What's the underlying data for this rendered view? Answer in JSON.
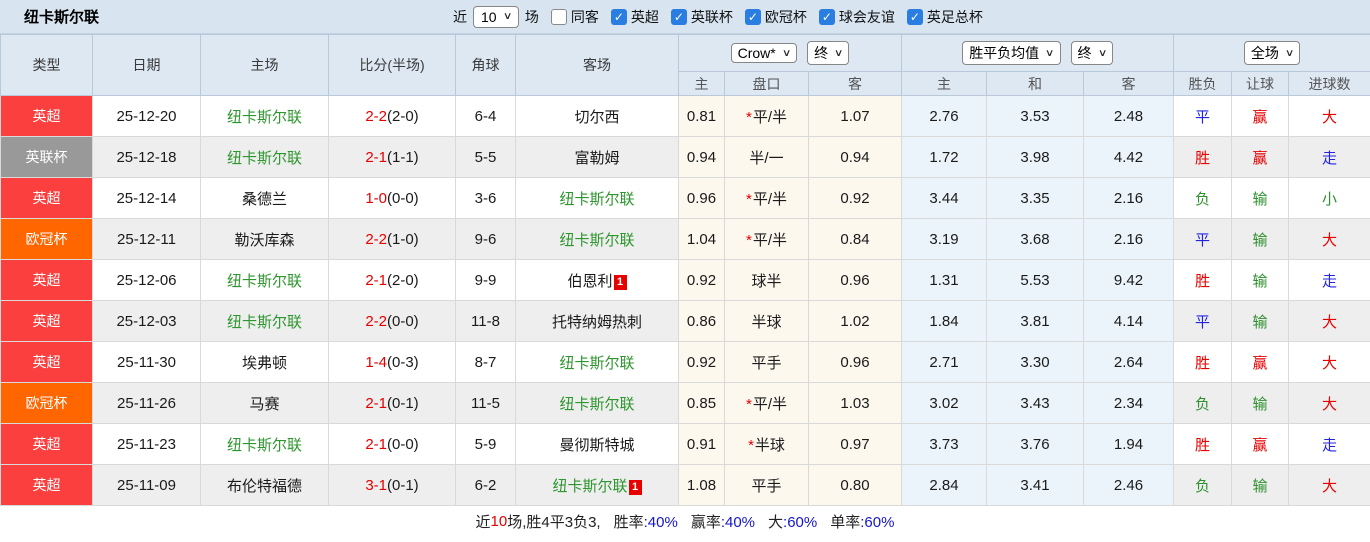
{
  "icons": {
    "chevron_down": "∨",
    "check": "✓"
  },
  "markers": {
    "star": "*"
  },
  "league_colors": {
    "英超": "#fb3e3e",
    "英联杯": "#999999",
    "欧冠杯": "#ff6600"
  },
  "result_colors": {
    "胜": "#e60000",
    "平": "#2424e0",
    "负": "#2e8f2e",
    "赢": "#e60000",
    "输": "#2e8f2e",
    "走": "#2424e0",
    "大": "#e60000",
    "小": "#2e8f2e"
  },
  "topbar": {
    "title": "纽卡斯尔联",
    "recent_label": "近",
    "recent_select": "10",
    "games_label": "场",
    "same_opponent": {
      "label": "同客",
      "checked": false
    },
    "league_filters": [
      {
        "label": "英超",
        "checked": true
      },
      {
        "label": "英联杯",
        "checked": true
      },
      {
        "label": "欧冠杯",
        "checked": true
      },
      {
        "label": "球会友谊",
        "checked": true
      },
      {
        "label": "英足总杯",
        "checked": true
      }
    ]
  },
  "table": {
    "headers": {
      "type": "类型",
      "date": "日期",
      "home": "主场",
      "score": "比分(半场)",
      "corners": "角球",
      "away": "客场",
      "asian_group": {
        "bookmaker_select": "Crow*",
        "time_select": "终",
        "cols": [
          "主",
          "盘口",
          "客"
        ]
      },
      "euro_group": {
        "metric_select": "胜平负均值",
        "time_select": "终",
        "cols": [
          "主",
          "和",
          "客"
        ]
      },
      "result_group": {
        "scope_select": "全场",
        "cols": [
          "胜负",
          "让球",
          "进球数"
        ]
      }
    },
    "matches": [
      {
        "league": "英超",
        "date": "25-12-20",
        "home": "纽卡斯尔联",
        "home_self": true,
        "home_card": "",
        "score_ft": "2-2",
        "score_ht": "(2-0)",
        "corners": "6-4",
        "away": "切尔西",
        "away_self": false,
        "away_card": "",
        "ah_home": "0.81",
        "ah_star": true,
        "ah_line": "平/半",
        "ah_away": "1.07",
        "eu_home": "2.76",
        "eu_draw": "3.53",
        "eu_away": "2.48",
        "r_outcome": "平",
        "r_handicap": "赢",
        "r_goals": "大"
      },
      {
        "league": "英联杯",
        "date": "25-12-18",
        "home": "纽卡斯尔联",
        "home_self": true,
        "home_card": "",
        "score_ft": "2-1",
        "score_ht": "(1-1)",
        "corners": "5-5",
        "away": "富勒姆",
        "away_self": false,
        "away_card": "",
        "ah_home": "0.94",
        "ah_star": false,
        "ah_line": "半/一",
        "ah_away": "0.94",
        "eu_home": "1.72",
        "eu_draw": "3.98",
        "eu_away": "4.42",
        "r_outcome": "胜",
        "r_handicap": "赢",
        "r_goals": "走"
      },
      {
        "league": "英超",
        "date": "25-12-14",
        "home": "桑德兰",
        "home_self": false,
        "home_card": "",
        "score_ft": "1-0",
        "score_ht": "(0-0)",
        "corners": "3-6",
        "away": "纽卡斯尔联",
        "away_self": true,
        "away_card": "",
        "ah_home": "0.96",
        "ah_star": true,
        "ah_line": "平/半",
        "ah_away": "0.92",
        "eu_home": "3.44",
        "eu_draw": "3.35",
        "eu_away": "2.16",
        "r_outcome": "负",
        "r_handicap": "输",
        "r_goals": "小"
      },
      {
        "league": "欧冠杯",
        "date": "25-12-11",
        "home": "勒沃库森",
        "home_self": false,
        "home_card": "",
        "score_ft": "2-2",
        "score_ht": "(1-0)",
        "corners": "9-6",
        "away": "纽卡斯尔联",
        "away_self": true,
        "away_card": "",
        "ah_home": "1.04",
        "ah_star": true,
        "ah_line": "平/半",
        "ah_away": "0.84",
        "eu_home": "3.19",
        "eu_draw": "3.68",
        "eu_away": "2.16",
        "r_outcome": "平",
        "r_handicap": "输",
        "r_goals": "大"
      },
      {
        "league": "英超",
        "date": "25-12-06",
        "home": "纽卡斯尔联",
        "home_self": true,
        "home_card": "",
        "score_ft": "2-1",
        "score_ht": "(2-0)",
        "corners": "9-9",
        "away": "伯恩利",
        "away_self": false,
        "away_card": "1",
        "ah_home": "0.92",
        "ah_star": false,
        "ah_line": "球半",
        "ah_away": "0.96",
        "eu_home": "1.31",
        "eu_draw": "5.53",
        "eu_away": "9.42",
        "r_outcome": "胜",
        "r_handicap": "输",
        "r_goals": "走"
      },
      {
        "league": "英超",
        "date": "25-12-03",
        "home": "纽卡斯尔联",
        "home_self": true,
        "home_card": "",
        "score_ft": "2-2",
        "score_ht": "(0-0)",
        "corners": "11-8",
        "away": "托特纳姆热刺",
        "away_self": false,
        "away_card": "",
        "ah_home": "0.86",
        "ah_star": false,
        "ah_line": "半球",
        "ah_away": "1.02",
        "eu_home": "1.84",
        "eu_draw": "3.81",
        "eu_away": "4.14",
        "r_outcome": "平",
        "r_handicap": "输",
        "r_goals": "大"
      },
      {
        "league": "英超",
        "date": "25-11-30",
        "home": "埃弗顿",
        "home_self": false,
        "home_card": "",
        "score_ft": "1-4",
        "score_ht": "(0-3)",
        "corners": "8-7",
        "away": "纽卡斯尔联",
        "away_self": true,
        "away_card": "",
        "ah_home": "0.92",
        "ah_star": false,
        "ah_line": "平手",
        "ah_away": "0.96",
        "eu_home": "2.71",
        "eu_draw": "3.30",
        "eu_away": "2.64",
        "r_outcome": "胜",
        "r_handicap": "赢",
        "r_goals": "大"
      },
      {
        "league": "欧冠杯",
        "date": "25-11-26",
        "home": "马赛",
        "home_self": false,
        "home_card": "",
        "score_ft": "2-1",
        "score_ht": "(0-1)",
        "corners": "11-5",
        "away": "纽卡斯尔联",
        "away_self": true,
        "away_card": "",
        "ah_home": "0.85",
        "ah_star": true,
        "ah_line": "平/半",
        "ah_away": "1.03",
        "eu_home": "3.02",
        "eu_draw": "3.43",
        "eu_away": "2.34",
        "r_outcome": "负",
        "r_handicap": "输",
        "r_goals": "大"
      },
      {
        "league": "英超",
        "date": "25-11-23",
        "home": "纽卡斯尔联",
        "home_self": true,
        "home_card": "",
        "score_ft": "2-1",
        "score_ht": "(0-0)",
        "corners": "5-9",
        "away": "曼彻斯特城",
        "away_self": false,
        "away_card": "",
        "ah_home": "0.91",
        "ah_star": true,
        "ah_line": "半球",
        "ah_away": "0.97",
        "eu_home": "3.73",
        "eu_draw": "3.76",
        "eu_away": "1.94",
        "r_outcome": "胜",
        "r_handicap": "赢",
        "r_goals": "走"
      },
      {
        "league": "英超",
        "date": "25-11-09",
        "home": "布伦特福德",
        "home_self": false,
        "home_card": "",
        "score_ft": "3-1",
        "score_ht": "(0-1)",
        "corners": "6-2",
        "away": "纽卡斯尔联",
        "away_self": true,
        "away_card": "1",
        "ah_home": "1.08",
        "ah_star": false,
        "ah_line": "平手",
        "ah_away": "0.80",
        "eu_home": "2.84",
        "eu_draw": "3.41",
        "eu_away": "2.46",
        "r_outcome": "负",
        "r_handicap": "输",
        "r_goals": "大"
      }
    ]
  },
  "footer": {
    "lead": "近",
    "count": "10",
    "tail": "场,胜4平3负3,",
    "stats": [
      {
        "label": "胜率",
        "value": ":40%"
      },
      {
        "label": "赢率",
        "value": ":40%"
      },
      {
        "label": "大",
        "value": ":60%"
      },
      {
        "label": "单率",
        "value": ":60%"
      }
    ]
  }
}
